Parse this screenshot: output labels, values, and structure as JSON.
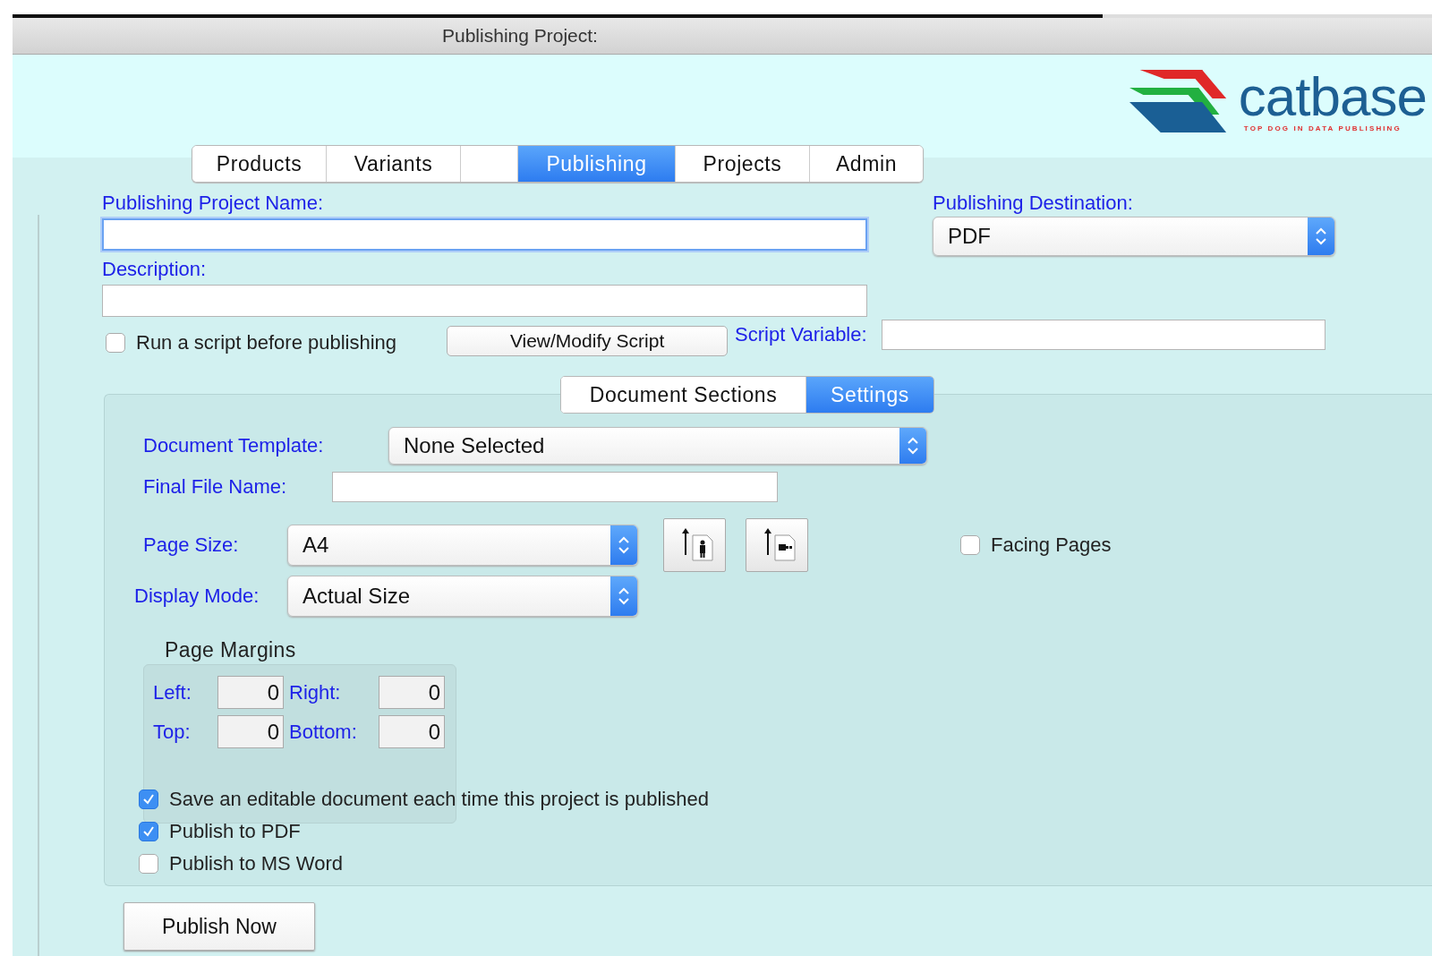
{
  "window": {
    "title": "Publishing Project:"
  },
  "logo": {
    "name": "catbase",
    "tagline": "TOP DOG IN DATA PUBLISHING"
  },
  "tabs": [
    {
      "kind": "label",
      "label": "Products",
      "selected": false
    },
    {
      "kind": "label",
      "label": "Variants",
      "selected": false
    },
    {
      "kind": "spacer",
      "selected": false
    },
    {
      "kind": "label",
      "label": "Publishing",
      "selected": true
    },
    {
      "kind": "label",
      "label": "Projects",
      "selected": false
    },
    {
      "kind": "label",
      "label": "Admin",
      "selected": false
    }
  ],
  "project_name": {
    "label": "Publishing Project Name:",
    "focused": true
  },
  "destination": {
    "label": "Publishing Destination:",
    "value": "PDF"
  },
  "description": {
    "label": "Description:"
  },
  "run_script": {
    "label": "Run a script before publishing",
    "checked": false
  },
  "view_script_button": "View/Modify Script",
  "script_variable": {
    "label": "Script Variable:"
  },
  "subtabs": [
    {
      "label": "Document Sections",
      "selected": false
    },
    {
      "label": "Settings",
      "selected": true
    }
  ],
  "settings": {
    "document_template": {
      "label": "Document Template:",
      "value": "None Selected"
    },
    "final_file_name": {
      "label": "Final File Name:"
    },
    "page_size": {
      "label": "Page Size:",
      "value": "A4"
    },
    "orientation": [
      {
        "kind": "portrait"
      },
      {
        "kind": "landscape"
      }
    ],
    "facing_pages": {
      "label": "Facing Pages",
      "checked": false
    },
    "display_mode": {
      "label": "Display Mode:",
      "value": "Actual Size"
    },
    "page_margins": {
      "title": "Page Margins",
      "fields": [
        {
          "label": "Left:",
          "value": "0"
        },
        {
          "label": "Right:",
          "value": "0"
        },
        {
          "label": "Top:",
          "value": "0"
        },
        {
          "label": "Bottom:",
          "value": "0"
        }
      ]
    },
    "options": [
      {
        "label": "Save an editable document each time this project is published",
        "checked": true
      },
      {
        "label": "Publish to PDF",
        "checked": true
      },
      {
        "label": "Publish to MS Word",
        "checked": false
      }
    ]
  },
  "publish_button": "Publish Now"
}
